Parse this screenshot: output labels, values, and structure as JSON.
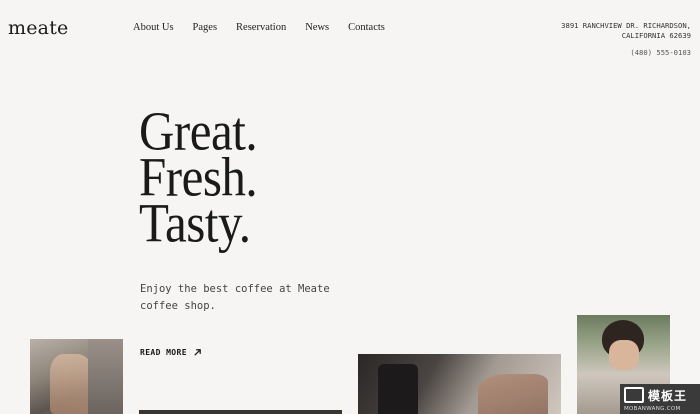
{
  "brand": {
    "logo": "meate"
  },
  "nav": {
    "items": [
      "About Us",
      "Pages",
      "Reservation",
      "News",
      "Contacts"
    ]
  },
  "contact": {
    "address_line1": "3891 RANCHVIEW DR. RICHARDSON,",
    "address_line2": "CALIFORNIA 62639",
    "phone": "(480) 555-0103"
  },
  "hero": {
    "line1": "Great.",
    "line2": "Fresh.",
    "line3": "Tasty.",
    "tagline": "Enjoy the best coffee at Meate coffee shop.",
    "cta": "READ MORE"
  },
  "icons": {
    "cta_icon": "arrow-up-right-icon"
  },
  "watermark": {
    "top": "模板王",
    "bottom": "MOBANWANG.COM"
  }
}
